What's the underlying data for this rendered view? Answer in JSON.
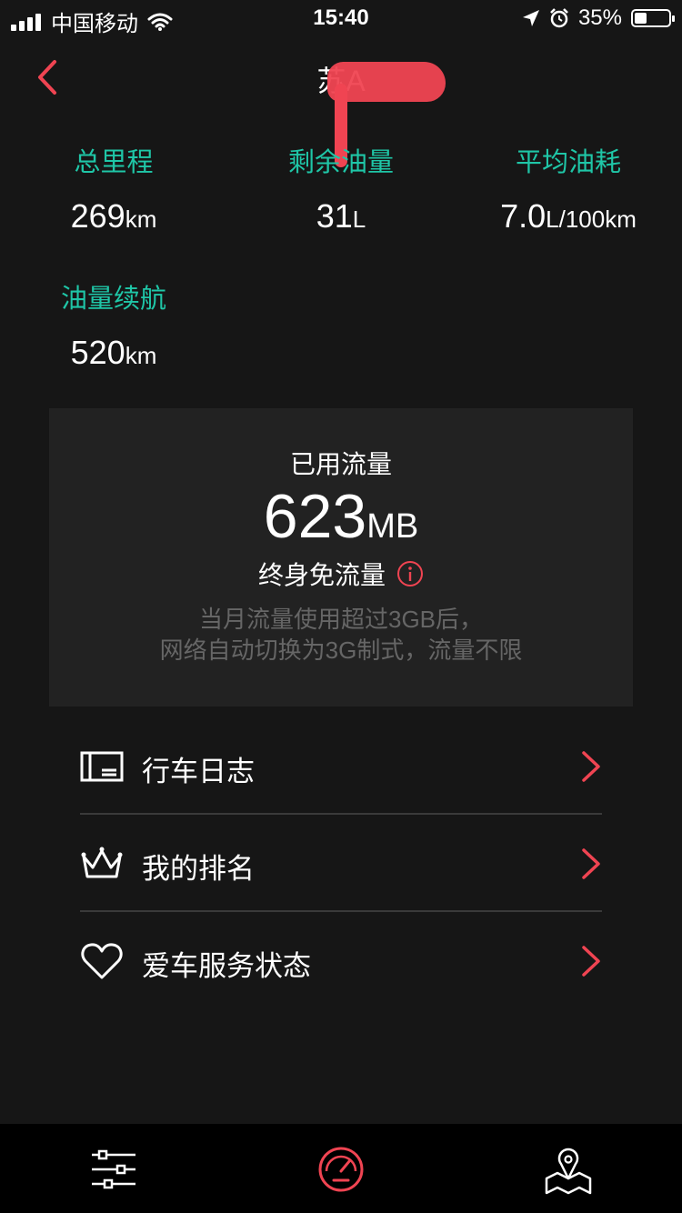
{
  "status_bar": {
    "carrier": "中国移动",
    "time": "15:40",
    "battery": "35%",
    "battery_level": 0.35
  },
  "header": {
    "title": "苏A"
  },
  "stats": {
    "total_mileage": {
      "label": "总里程",
      "value": "269",
      "unit": "km"
    },
    "remaining_fuel": {
      "label": "剩余油量",
      "value": "31",
      "unit": "L"
    },
    "avg_consumption": {
      "label": "平均油耗",
      "value": "7.0",
      "unit": "L/100km"
    },
    "fuel_range": {
      "label": "油量续航",
      "value": "520",
      "unit": "km"
    }
  },
  "data_card": {
    "title": "已用流量",
    "value": "623",
    "unit": "MB",
    "plan": "终身免流量",
    "note_line1": "当月流量使用超过3GB后，",
    "note_line2": "网络自动切换为3G制式，流量不限"
  },
  "menu": {
    "items": [
      {
        "label": "行车日志",
        "icon": "log-icon"
      },
      {
        "label": "我的排名",
        "icon": "crown-icon"
      },
      {
        "label": "爱车服务状态",
        "icon": "heart-icon"
      }
    ]
  },
  "tabbar": {
    "tabs": [
      {
        "icon": "settings-sliders-icon"
      },
      {
        "icon": "speedometer-icon",
        "active": true
      },
      {
        "icon": "map-pin-icon"
      }
    ]
  },
  "colors": {
    "accent": "#f04452",
    "teal": "#1fc6a7",
    "background": "#161616",
    "card": "#222222"
  }
}
